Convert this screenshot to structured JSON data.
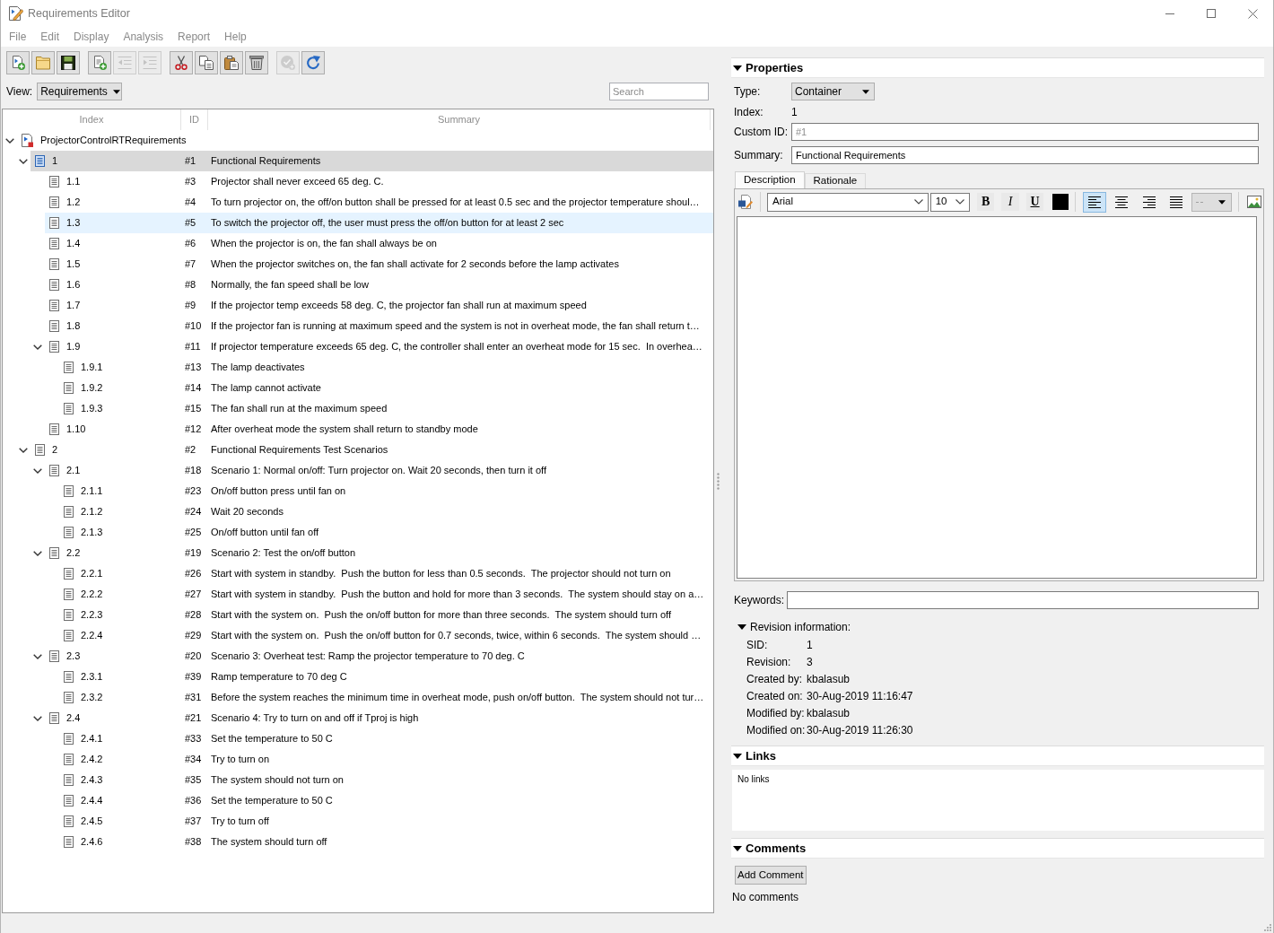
{
  "window": {
    "title": "Requirements Editor"
  },
  "menu": [
    "File",
    "Edit",
    "Display",
    "Analysis",
    "Report",
    "Help"
  ],
  "toolbar": {
    "groups": [
      {
        "buttons": [
          {
            "kind": "new",
            "disabled": false
          },
          {
            "kind": "open",
            "disabled": false
          },
          {
            "kind": "save",
            "disabled": false
          }
        ]
      },
      {
        "buttons": [
          {
            "kind": "add",
            "disabled": false
          },
          {
            "kind": "outdent",
            "disabled": true
          },
          {
            "kind": "indent",
            "disabled": true
          }
        ]
      },
      {
        "buttons": [
          {
            "kind": "cut",
            "disabled": false
          },
          {
            "kind": "copy",
            "disabled": false
          },
          {
            "kind": "paste",
            "disabled": false
          },
          {
            "kind": "delete",
            "disabled": false
          }
        ]
      },
      {
        "buttons": [
          {
            "kind": "check",
            "disabled": true
          },
          {
            "kind": "refresh",
            "disabled": false
          }
        ]
      }
    ]
  },
  "view": {
    "label": "View:",
    "value": "Requirements"
  },
  "search": {
    "placeholder": "Search"
  },
  "tree": {
    "columns": [
      "Index",
      "ID",
      "Summary"
    ],
    "root": {
      "label": "ProjectorControlRTRequirements",
      "expanded": true,
      "selected": false,
      "hovered": false,
      "children": [
        {
          "index": "1",
          "id": "#1",
          "summary": "Functional Requirements",
          "selected": true,
          "hovered": false,
          "expanded": true,
          "children": [
            {
              "index": "1.1",
              "id": "#3",
              "summary": "Projector shall never exceed 65 deg. C.",
              "selected": false,
              "hovered": false
            },
            {
              "index": "1.2",
              "id": "#4",
              "summary": "To turn projector on, the off/on button shall be pressed for at least 0.5 sec and the projector temperature shoul…",
              "selected": false,
              "hovered": false
            },
            {
              "index": "1.3",
              "id": "#5",
              "summary": "To switch the projector off, the user must press the off/on button for at least 2 sec",
              "selected": false,
              "hovered": true
            },
            {
              "index": "1.4",
              "id": "#6",
              "summary": "When the projector is on, the fan shall always be on",
              "selected": false,
              "hovered": false
            },
            {
              "index": "1.5",
              "id": "#7",
              "summary": "When the projector switches on, the fan shall activate for 2 seconds before the lamp activates",
              "selected": false,
              "hovered": false
            },
            {
              "index": "1.6",
              "id": "#8",
              "summary": "Normally, the fan speed shall be low",
              "selected": false,
              "hovered": false
            },
            {
              "index": "1.7",
              "id": "#9",
              "summary": "If the projector temp exceeds 58 deg. C, the projector fan shall run at maximum speed",
              "selected": false,
              "hovered": false
            },
            {
              "index": "1.8",
              "id": "#10",
              "summary": "If the projector fan is running at maximum speed and the system is not in overheat mode, the fan shall return t…",
              "selected": false,
              "hovered": false
            },
            {
              "index": "1.9",
              "id": "#11",
              "summary": "If projector temperature exceeds 65 deg. C, the controller shall enter an overheat mode for 15 sec.  In overhea…",
              "selected": false,
              "hovered": false,
              "expanded": true,
              "children": [
                {
                  "index": "1.9.1",
                  "id": "#13",
                  "summary": "The lamp deactivates",
                  "selected": false,
                  "hovered": false
                },
                {
                  "index": "1.9.2",
                  "id": "#14",
                  "summary": "The lamp cannot activate",
                  "selected": false,
                  "hovered": false
                },
                {
                  "index": "1.9.3",
                  "id": "#15",
                  "summary": "The fan shall run at the maximum speed",
                  "selected": false,
                  "hovered": false
                }
              ]
            },
            {
              "index": "1.10",
              "id": "#12",
              "summary": "After overheat mode the system shall return to standby mode",
              "selected": false,
              "hovered": false
            }
          ]
        },
        {
          "index": "2",
          "id": "#2",
          "summary": "Functional Requirements Test Scenarios",
          "selected": false,
          "hovered": false,
          "expanded": true,
          "children": [
            {
              "index": "2.1",
              "id": "#18",
              "summary": "Scenario 1: Normal on/off: Turn projector on. Wait 20 seconds, then turn it off",
              "selected": false,
              "hovered": false,
              "expanded": true,
              "children": [
                {
                  "index": "2.1.1",
                  "id": "#23",
                  "summary": "On/off button press until fan on",
                  "selected": false,
                  "hovered": false
                },
                {
                  "index": "2.1.2",
                  "id": "#24",
                  "summary": "Wait 20 seconds",
                  "selected": false,
                  "hovered": false
                },
                {
                  "index": "2.1.3",
                  "id": "#25",
                  "summary": "On/off button until fan off",
                  "selected": false,
                  "hovered": false
                }
              ]
            },
            {
              "index": "2.2",
              "id": "#19",
              "summary": "Scenario 2: Test the on/off button",
              "selected": false,
              "hovered": false,
              "expanded": true,
              "children": [
                {
                  "index": "2.2.1",
                  "id": "#26",
                  "summary": "Start with system in standby.  Push the button for less than 0.5 seconds.  The projector should not turn on",
                  "selected": false,
                  "hovered": false
                },
                {
                  "index": "2.2.2",
                  "id": "#27",
                  "summary": "Start with system in standby.  Push the button and hold for more than 3 seconds.  The system should stay on a…",
                  "selected": false,
                  "hovered": false
                },
                {
                  "index": "2.2.3",
                  "id": "#28",
                  "summary": "Start with the system on.  Push the on/off button for more than three seconds.  The system should turn off",
                  "selected": false,
                  "hovered": false
                },
                {
                  "index": "2.2.4",
                  "id": "#29",
                  "summary": "Start with the system on.  Push the on/off button for 0.7 seconds, twice, within 6 seconds.  The system should …",
                  "selected": false,
                  "hovered": false
                }
              ]
            },
            {
              "index": "2.3",
              "id": "#20",
              "summary": "Scenario 3: Overheat test: Ramp the projector temperature to 70 deg. C",
              "selected": false,
              "hovered": false,
              "expanded": true,
              "children": [
                {
                  "index": "2.3.1",
                  "id": "#39",
                  "summary": "Ramp temperature to 70 deg C",
                  "selected": false,
                  "hovered": false
                },
                {
                  "index": "2.3.2",
                  "id": "#31",
                  "summary": "Before the system reaches the minimum time in overheat mode, push on/off button.  The system should not tur…",
                  "selected": false,
                  "hovered": false
                }
              ]
            },
            {
              "index": "2.4",
              "id": "#21",
              "summary": "Scenario 4: Try to turn on and off if Tproj is high",
              "selected": false,
              "hovered": false,
              "expanded": true,
              "children": [
                {
                  "index": "2.4.1",
                  "id": "#33",
                  "summary": "Set the temperature to 50 C",
                  "selected": false,
                  "hovered": false
                },
                {
                  "index": "2.4.2",
                  "id": "#34",
                  "summary": "Try to turn on",
                  "selected": false,
                  "hovered": false
                },
                {
                  "index": "2.4.3",
                  "id": "#35",
                  "summary": "The system should not turn on",
                  "selected": false,
                  "hovered": false
                },
                {
                  "index": "2.4.4",
                  "id": "#36",
                  "summary": "Set the temperature to 50 C",
                  "selected": false,
                  "hovered": false
                },
                {
                  "index": "2.4.5",
                  "id": "#37",
                  "summary": "Try to turn off",
                  "selected": false,
                  "hovered": false
                },
                {
                  "index": "2.4.6",
                  "id": "#38",
                  "summary": "The system should turn off",
                  "selected": false,
                  "hovered": false
                }
              ]
            }
          ]
        }
      ]
    }
  },
  "properties": {
    "title": "Properties",
    "expanded": true,
    "type": {
      "label": "Type:",
      "value": "Container"
    },
    "index": {
      "label": "Index:",
      "value": "1"
    },
    "custom_id": {
      "label": "Custom ID:",
      "placeholder": "#1"
    },
    "summary": {
      "label": "Summary:",
      "value": "Functional Requirements"
    },
    "tabs": [
      {
        "label": "Description",
        "selected": true
      },
      {
        "label": "Rationale",
        "selected": false
      }
    ],
    "editor": {
      "font": "Arial",
      "size": "10",
      "styles": [
        {
          "kind": "bold",
          "label": "B"
        },
        {
          "kind": "italic",
          "label": "I"
        },
        {
          "kind": "underline",
          "label": "U"
        }
      ],
      "alignments": [
        {
          "kind": "left",
          "selected": true
        },
        {
          "kind": "center",
          "selected": false
        },
        {
          "kind": "right",
          "selected": false
        },
        {
          "kind": "justify",
          "selected": false
        }
      ]
    },
    "keywords": {
      "label": "Keywords:"
    },
    "revision": {
      "title": "Revision information:",
      "expanded": true,
      "fields": [
        {
          "label": "SID:",
          "value": "1"
        },
        {
          "label": "Revision:",
          "value": "3"
        },
        {
          "label": "Created by:",
          "value": "kbalasub"
        },
        {
          "label": "Created on:",
          "value": "30-Aug-2019 11:16:47"
        },
        {
          "label": "Modified by:",
          "value": "kbalasub"
        },
        {
          "label": "Modified on:",
          "value": "30-Aug-2019 11:26:30"
        }
      ]
    }
  },
  "links": {
    "title": "Links",
    "expanded": true,
    "empty_text": "No links"
  },
  "comments": {
    "title": "Comments",
    "expanded": true,
    "button": "Add Comment",
    "empty_text": "No comments"
  }
}
